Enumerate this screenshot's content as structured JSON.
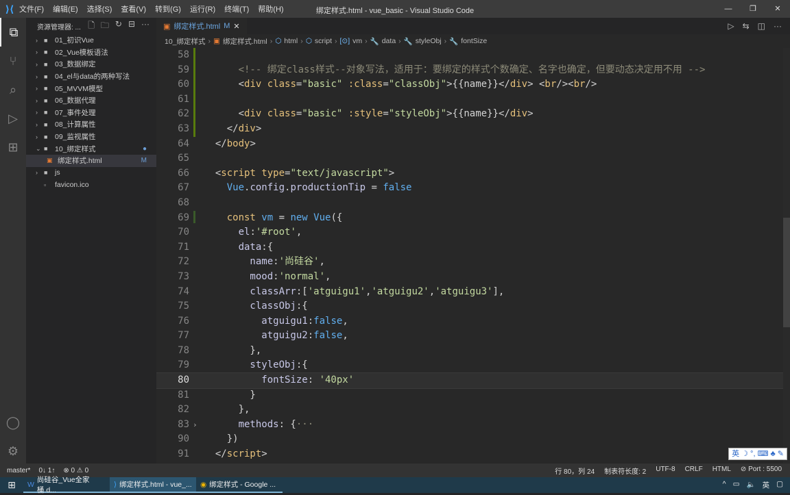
{
  "titlebar": {
    "menus": [
      "文件(F)",
      "编辑(E)",
      "选择(S)",
      "查看(V)",
      "转到(G)",
      "运行(R)",
      "终端(T)",
      "帮助(H)"
    ],
    "title": "绑定样式.html - vue_basic - Visual Studio Code"
  },
  "sidebar": {
    "title": "资源管理器: ...",
    "items": [
      {
        "label": "01_初识Vue",
        "type": "folder"
      },
      {
        "label": "02_Vue模板语法",
        "type": "folder"
      },
      {
        "label": "03_数据绑定",
        "type": "folder"
      },
      {
        "label": "04_el与data的两种写法",
        "type": "folder"
      },
      {
        "label": "05_MVVM模型",
        "type": "folder"
      },
      {
        "label": "06_数据代理",
        "type": "folder"
      },
      {
        "label": "07_事件处理",
        "type": "folder"
      },
      {
        "label": "08_计算属性",
        "type": "folder"
      },
      {
        "label": "09_监视属性",
        "type": "folder"
      },
      {
        "label": "10_绑定样式",
        "type": "folder-open",
        "badge": "●"
      },
      {
        "label": "绑定样式.html",
        "type": "file-html",
        "badge": "M"
      },
      {
        "label": "js",
        "type": "folder"
      },
      {
        "label": "favicon.ico",
        "type": "file"
      }
    ]
  },
  "tab": {
    "label": "绑定样式.html",
    "badge": "M"
  },
  "breadcrumb": [
    "10_绑定样式",
    "绑定样式.html",
    "html",
    "script",
    "vm",
    "data",
    "styleObj",
    "fontSize"
  ],
  "code": [
    {
      "n": "58",
      "t": []
    },
    {
      "n": "59",
      "t": [
        [
          "c",
          "      <!-- 绑定class样式--对象写法，适用于：要绑定的样式个数确定、名字也确定，但要动态决定用不用 -->"
        ]
      ]
    },
    {
      "n": "60",
      "t": [
        [
          "t",
          "      <"
        ],
        [
          "g",
          "div"
        ],
        [
          "g",
          " class"
        ],
        [
          "t",
          "="
        ],
        [
          "s",
          "\"basic\""
        ],
        [
          "g",
          " :class"
        ],
        [
          "t",
          "="
        ],
        [
          "s",
          "\"classObj\""
        ],
        [
          "t",
          ">{{name}}</"
        ],
        [
          "g",
          "div"
        ],
        [
          "t",
          "> <"
        ],
        [
          "g",
          "br"
        ],
        [
          "t",
          "/><"
        ],
        [
          "g",
          "br"
        ],
        [
          "t",
          "/>"
        ]
      ]
    },
    {
      "n": "61",
      "t": []
    },
    {
      "n": "62",
      "t": [
        [
          "t",
          "      <"
        ],
        [
          "g",
          "div"
        ],
        [
          "g",
          " class"
        ],
        [
          "t",
          "="
        ],
        [
          "s",
          "\"basic\""
        ],
        [
          "g",
          " :style"
        ],
        [
          "t",
          "="
        ],
        [
          "s",
          "\"styleObj\""
        ],
        [
          "t",
          ">{{name}}</"
        ],
        [
          "g",
          "div"
        ],
        [
          "t",
          ">"
        ]
      ]
    },
    {
      "n": "63",
      "t": [
        [
          "t",
          "    </"
        ],
        [
          "g",
          "div"
        ],
        [
          "t",
          ">"
        ]
      ]
    },
    {
      "n": "64",
      "t": [
        [
          "t",
          "  </"
        ],
        [
          "g",
          "body"
        ],
        [
          "t",
          ">"
        ]
      ]
    },
    {
      "n": "65",
      "t": []
    },
    {
      "n": "66",
      "t": [
        [
          "t",
          "  <"
        ],
        [
          "g",
          "script"
        ],
        [
          "g",
          " type"
        ],
        [
          "t",
          "="
        ],
        [
          "s",
          "\"text/javascript\""
        ],
        [
          "t",
          ">"
        ]
      ]
    },
    {
      "n": "67",
      "t": [
        [
          "b",
          "    Vue"
        ],
        [
          "t",
          "."
        ],
        [
          "p",
          "config"
        ],
        [
          "t",
          "."
        ],
        [
          "p",
          "productionTip"
        ],
        [
          "t",
          " = "
        ],
        [
          "b",
          "false"
        ]
      ]
    },
    {
      "n": "68",
      "t": []
    },
    {
      "n": "69",
      "t": [
        [
          "k",
          "    const"
        ],
        [
          "b",
          " vm"
        ],
        [
          "t",
          " = "
        ],
        [
          "b",
          "new"
        ],
        [
          "b",
          " Vue"
        ],
        [
          "t",
          "({"
        ]
      ]
    },
    {
      "n": "70",
      "t": [
        [
          "p",
          "      el"
        ],
        [
          "t",
          ":"
        ],
        [
          "s",
          "'#root'"
        ],
        [
          "t",
          ","
        ]
      ]
    },
    {
      "n": "71",
      "t": [
        [
          "p",
          "      data"
        ],
        [
          "t",
          ":{"
        ]
      ]
    },
    {
      "n": "72",
      "t": [
        [
          "p",
          "        name"
        ],
        [
          "t",
          ":"
        ],
        [
          "s",
          "'尚硅谷'"
        ],
        [
          "t",
          ","
        ]
      ]
    },
    {
      "n": "73",
      "t": [
        [
          "p",
          "        mood"
        ],
        [
          "t",
          ":"
        ],
        [
          "s",
          "'normal'"
        ],
        [
          "t",
          ","
        ]
      ]
    },
    {
      "n": "74",
      "t": [
        [
          "p",
          "        classArr"
        ],
        [
          "t",
          ":["
        ],
        [
          "s",
          "'atguigu1'"
        ],
        [
          "t",
          ","
        ],
        [
          "s",
          "'atguigu2'"
        ],
        [
          "t",
          ","
        ],
        [
          "s",
          "'atguigu3'"
        ],
        [
          "t",
          "],"
        ]
      ]
    },
    {
      "n": "75",
      "t": [
        [
          "p",
          "        classObj"
        ],
        [
          "t",
          ":{"
        ]
      ]
    },
    {
      "n": "76",
      "t": [
        [
          "p",
          "          atguigu1"
        ],
        [
          "t",
          ":"
        ],
        [
          "b",
          "false"
        ],
        [
          "t",
          ","
        ]
      ]
    },
    {
      "n": "77",
      "t": [
        [
          "p",
          "          atguigu2"
        ],
        [
          "t",
          ":"
        ],
        [
          "b",
          "false"
        ],
        [
          "t",
          ","
        ]
      ]
    },
    {
      "n": "78",
      "t": [
        [
          "t",
          "        },"
        ]
      ]
    },
    {
      "n": "79",
      "t": [
        [
          "p",
          "        styleObj"
        ],
        [
          "t",
          ":{"
        ]
      ]
    },
    {
      "n": "80",
      "t": [
        [
          "p",
          "          fontSize"
        ],
        [
          "t",
          ": "
        ],
        [
          "s",
          "'40px'"
        ]
      ],
      "current": true
    },
    {
      "n": "81",
      "t": [
        [
          "t",
          "        }"
        ]
      ]
    },
    {
      "n": "82",
      "t": [
        [
          "t",
          "      },"
        ]
      ]
    },
    {
      "n": "83",
      "t": [
        [
          "p",
          "      methods"
        ],
        [
          "t",
          ": {"
        ],
        [
          "c",
          "···"
        ]
      ],
      "folded": true
    },
    {
      "n": "90",
      "t": [
        [
          "t",
          "    })"
        ]
      ]
    },
    {
      "n": "91",
      "t": [
        [
          "t",
          "  </"
        ],
        [
          "g",
          "script"
        ],
        [
          "t",
          ">"
        ]
      ]
    }
  ],
  "ime": "英 ☽ °, ⌨ ♣ ✎",
  "status": {
    "branch": "master*",
    "sync": "0↓ 1↑",
    "problems": "⊗ 0 ⚠ 0",
    "position": "行 80，列 24",
    "tab_size": "制表符长度: 2",
    "encoding": "UTF-8",
    "eol": "CRLF",
    "language": "HTML",
    "port": "⊘ Port : 5500"
  },
  "taskbar": {
    "items": [
      "尚硅谷_Vue全家桶.d...",
      "绑定样式.html - vue_...",
      "绑定样式 - Google ..."
    ],
    "tray": [
      "^",
      "英"
    ]
  }
}
